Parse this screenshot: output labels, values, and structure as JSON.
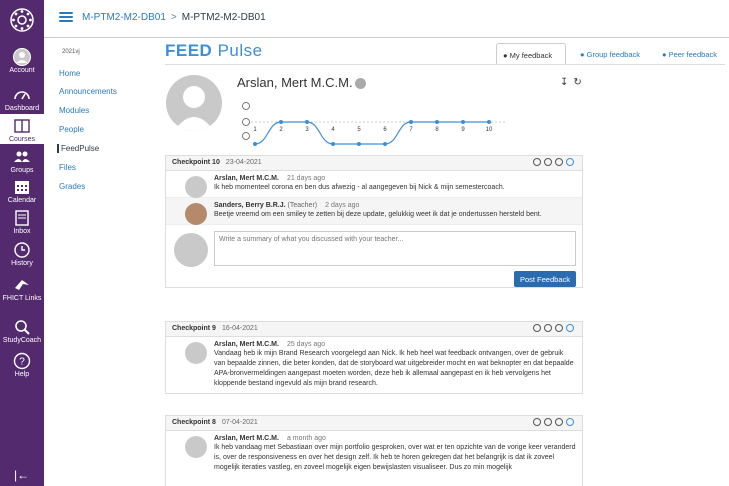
{
  "global_nav": {
    "items": [
      {
        "label": "Account",
        "icon": "account-icon"
      },
      {
        "label": "Dashboard",
        "icon": "dashboard-icon"
      },
      {
        "label": "Courses",
        "icon": "courses-icon",
        "active": true
      },
      {
        "label": "Groups",
        "icon": "groups-icon"
      },
      {
        "label": "Calendar",
        "icon": "calendar-icon"
      },
      {
        "label": "Inbox",
        "icon": "inbox-icon"
      },
      {
        "label": "History",
        "icon": "history-icon"
      },
      {
        "label": "FHICT Links",
        "icon": "fhict-links-icon"
      },
      {
        "label": "StudyCoach",
        "icon": "studycoach-icon"
      },
      {
        "label": "Help",
        "icon": "help-icon"
      }
    ],
    "collapse_glyph": "|←"
  },
  "header": {
    "breadcrumb": {
      "course": "M-PTM2-M2-DB01",
      "separator": ">",
      "current": "M-PTM2-M2-DB01"
    }
  },
  "course_nav": {
    "term": "2021vj",
    "links": [
      "Home",
      "Announcements",
      "Modules",
      "People",
      "FeedPulse",
      "Files",
      "Grades"
    ],
    "selected": "FeedPulse"
  },
  "feedpulse": {
    "logo_a": "FEED",
    "logo_b": "Pulse",
    "tabs": [
      "My feedback",
      "Group feedback",
      "Peer feedback"
    ],
    "active_tab": "My feedback",
    "student_name": "Arslan, Mert M.C.M.",
    "status_color": "#aaaaaa",
    "accent_color": "#3d8fd8"
  },
  "progress_chart": {
    "checkpoints": [
      1,
      2,
      3,
      4,
      5,
      6,
      7,
      8,
      9,
      10
    ],
    "levels": [
      1,
      2,
      2,
      1,
      1,
      1,
      2,
      2,
      2,
      2
    ],
    "level_icons": [
      "happy-face-icon",
      "neutral-face-icon",
      "sad-face-icon"
    ]
  },
  "checkpoints": [
    {
      "title": "Checkpoint 10",
      "date": "23-04-2021",
      "messages": [
        {
          "author": "Arslan, Mert M.C.M.",
          "role": "",
          "time": "21 days ago",
          "text": "Ik heb momenteel corona en ben dus afwezig - al aangegeven bij Nick & mijn semestercoach."
        },
        {
          "author": "Sanders, Berry B.R.J.",
          "role": "(Teacher)",
          "time": "2 days ago",
          "text": "Beetje vreemd om een smiley te zetten bij deze update, gelukkig weet ik dat je ondertussen hersteld bent."
        }
      ],
      "reply_placeholder": "Write a summary of what you discussed with your teacher...",
      "post_label": "Post Feedback"
    },
    {
      "title": "Checkpoint 9",
      "date": "16-04-2021",
      "messages": [
        {
          "author": "Arslan, Mert M.C.M.",
          "role": "",
          "time": "25 days ago",
          "text": "Vandaag heb ik mijn Brand Research voorgelegd aan Nick. Ik heb heel wat feedback ontvangen, over de gebruik van bepaalde zinnen, die beter konden, dat de storyboard wat uitgebreider mocht en wat beknopter en dat bepaalde APA-bronvermeldingen aangepast moeten worden, deze heb ik allemaal aangepast en ik heb vervolgens het kloppende bestand ingevuld als mijn brand research."
        }
      ]
    },
    {
      "title": "Checkpoint 8",
      "date": "07-04-2021",
      "messages": [
        {
          "author": "Arslan, Mert M.C.M.",
          "role": "",
          "time": "a month ago",
          "text": "Ik heb vandaag met Sebastiaan over mijn portfolio gesproken, over wat er ten opzichte van de vorige keer veranderd is, over de responsiveness en over het design zelf. Ik heb te horen gekregen dat het belangrijk is dat ik zoveel mogelijk iteraties vastleg, en zoveel mogelijk eigen bewijslasten visualiseer. Dus zo min mogelijk"
        }
      ]
    }
  ]
}
